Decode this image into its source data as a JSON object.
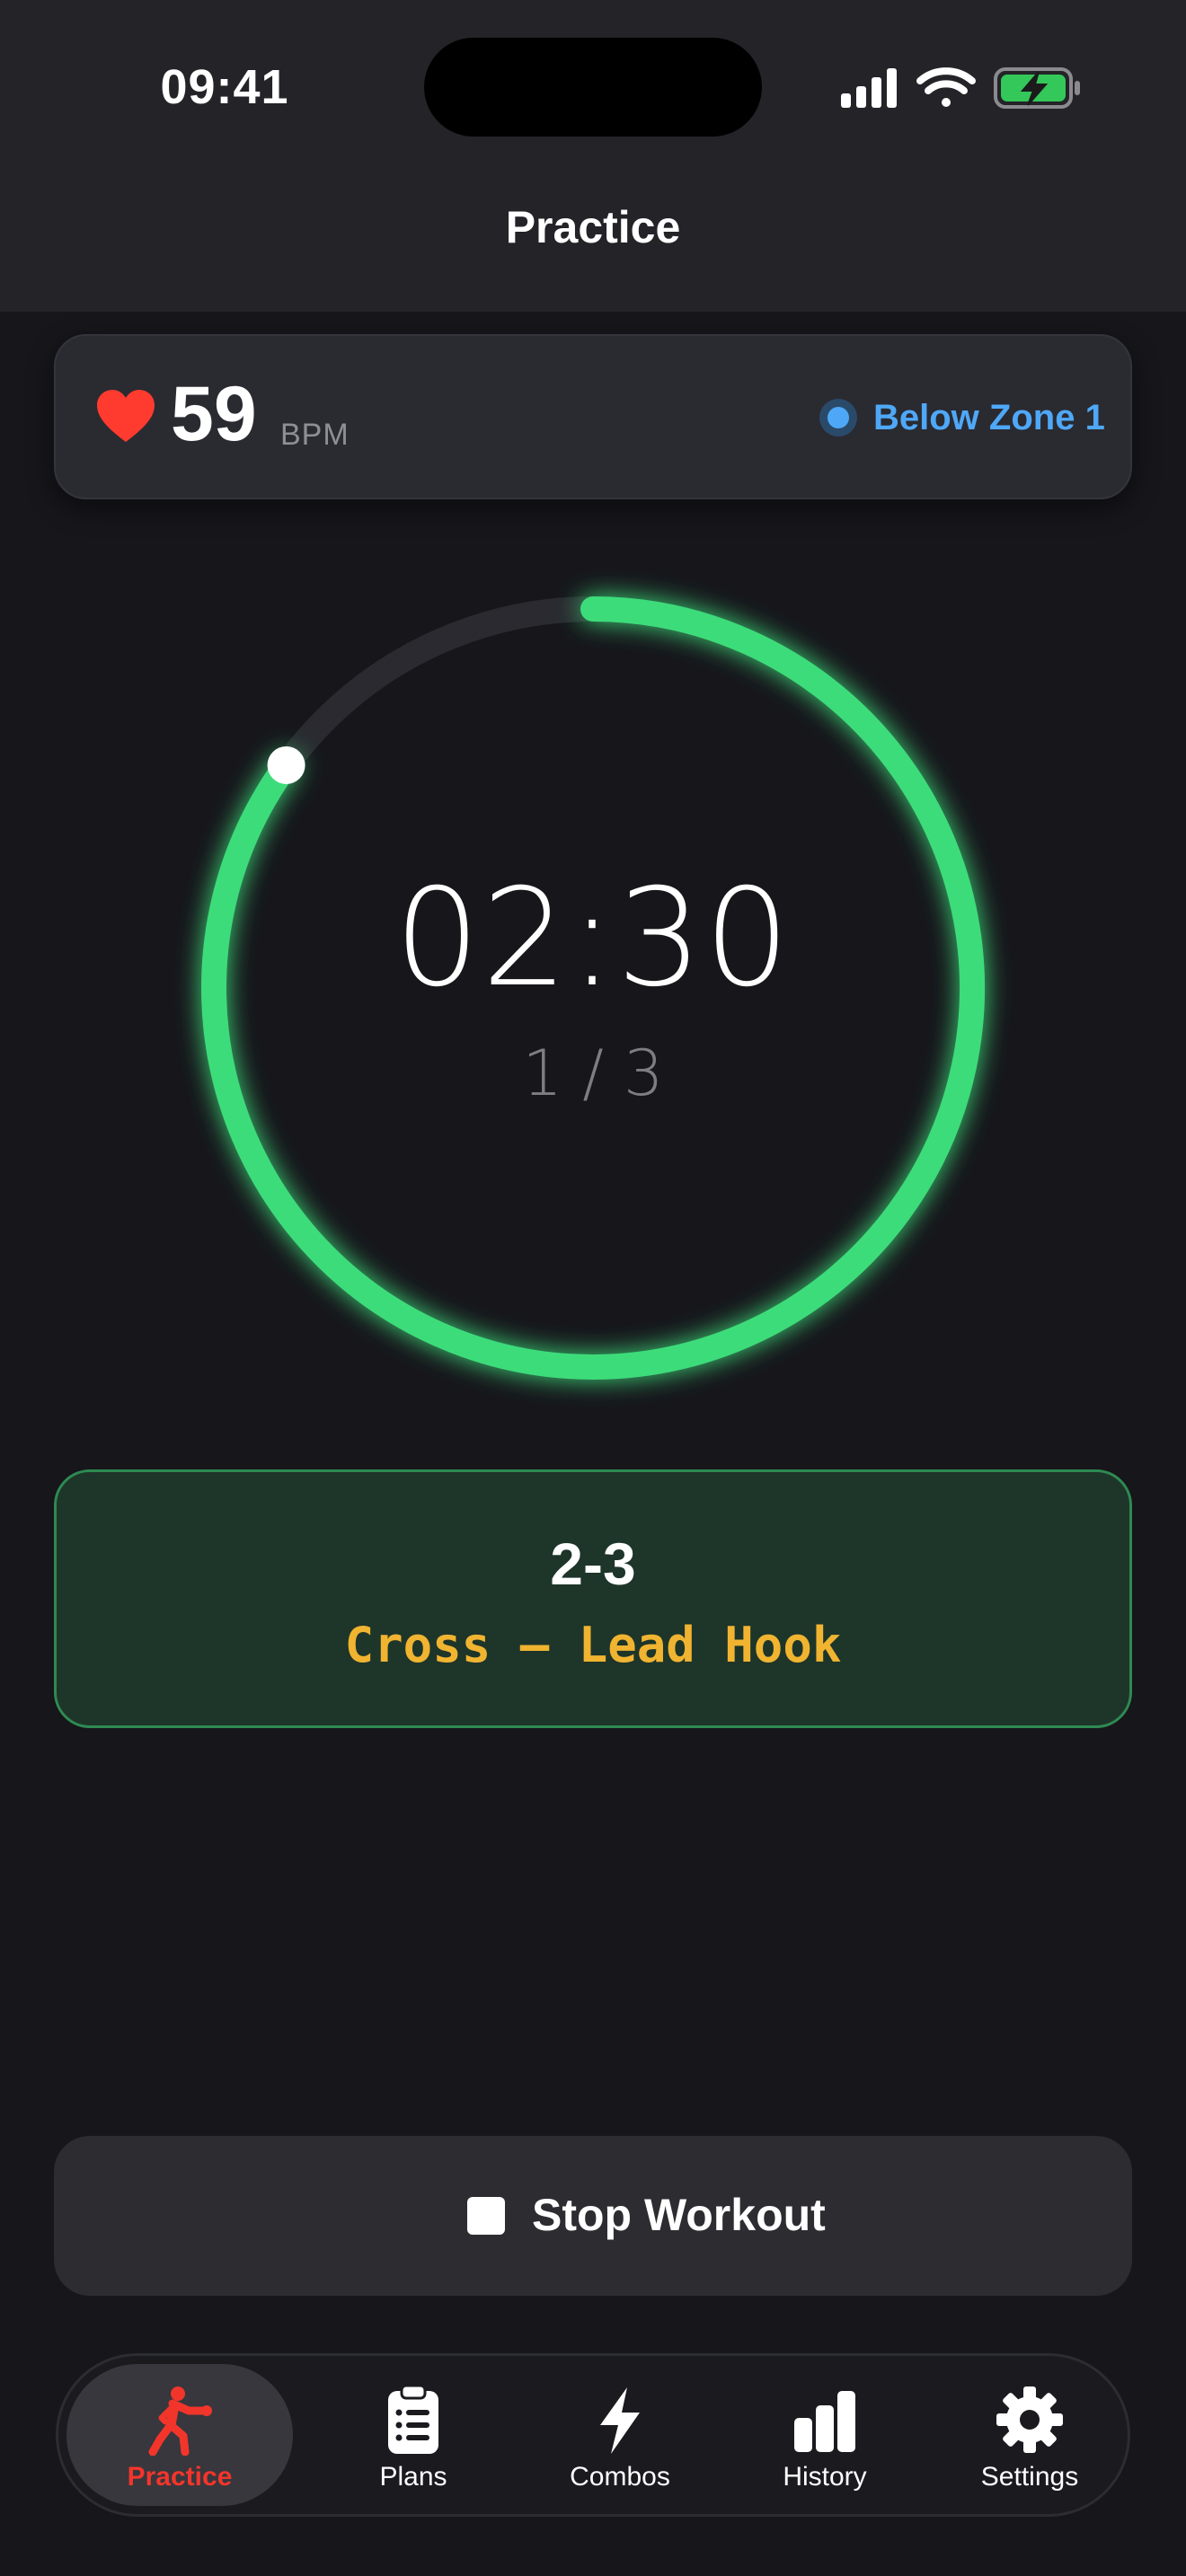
{
  "status_bar": {
    "time": "09:41",
    "icons": [
      "cellular-signal-icon",
      "wifi-icon",
      "battery-charging-icon"
    ],
    "battery_color": "#34c759"
  },
  "header": {
    "title": "Practice"
  },
  "heart_rate": {
    "value": "59",
    "unit": "BPM",
    "zone_label": "Below Zone 1",
    "icon": "heart-icon",
    "heart_color": "#ff3b30",
    "zone_color": "#4fa8f7"
  },
  "timer": {
    "time": "02:30",
    "round": "1 / 3",
    "progress": 0.85,
    "ring_color": "#3ddc7a"
  },
  "combo": {
    "code": "2-3",
    "name": "Cross – Lead Hook",
    "accent_color": "#f0b431"
  },
  "actions": {
    "stop_label": "Stop Workout",
    "stop_icon": "stop-square-icon"
  },
  "tab_bar": {
    "active_color": "#f2352b",
    "tabs": [
      {
        "label": "Practice",
        "icon": "boxer-figure-icon",
        "active": true
      },
      {
        "label": "Plans",
        "icon": "clipboard-list-icon",
        "active": false
      },
      {
        "label": "Combos",
        "icon": "lightning-bolt-icon",
        "active": false
      },
      {
        "label": "History",
        "icon": "bar-chart-icon",
        "active": false
      },
      {
        "label": "Settings",
        "icon": "gear-icon",
        "active": false
      }
    ]
  }
}
